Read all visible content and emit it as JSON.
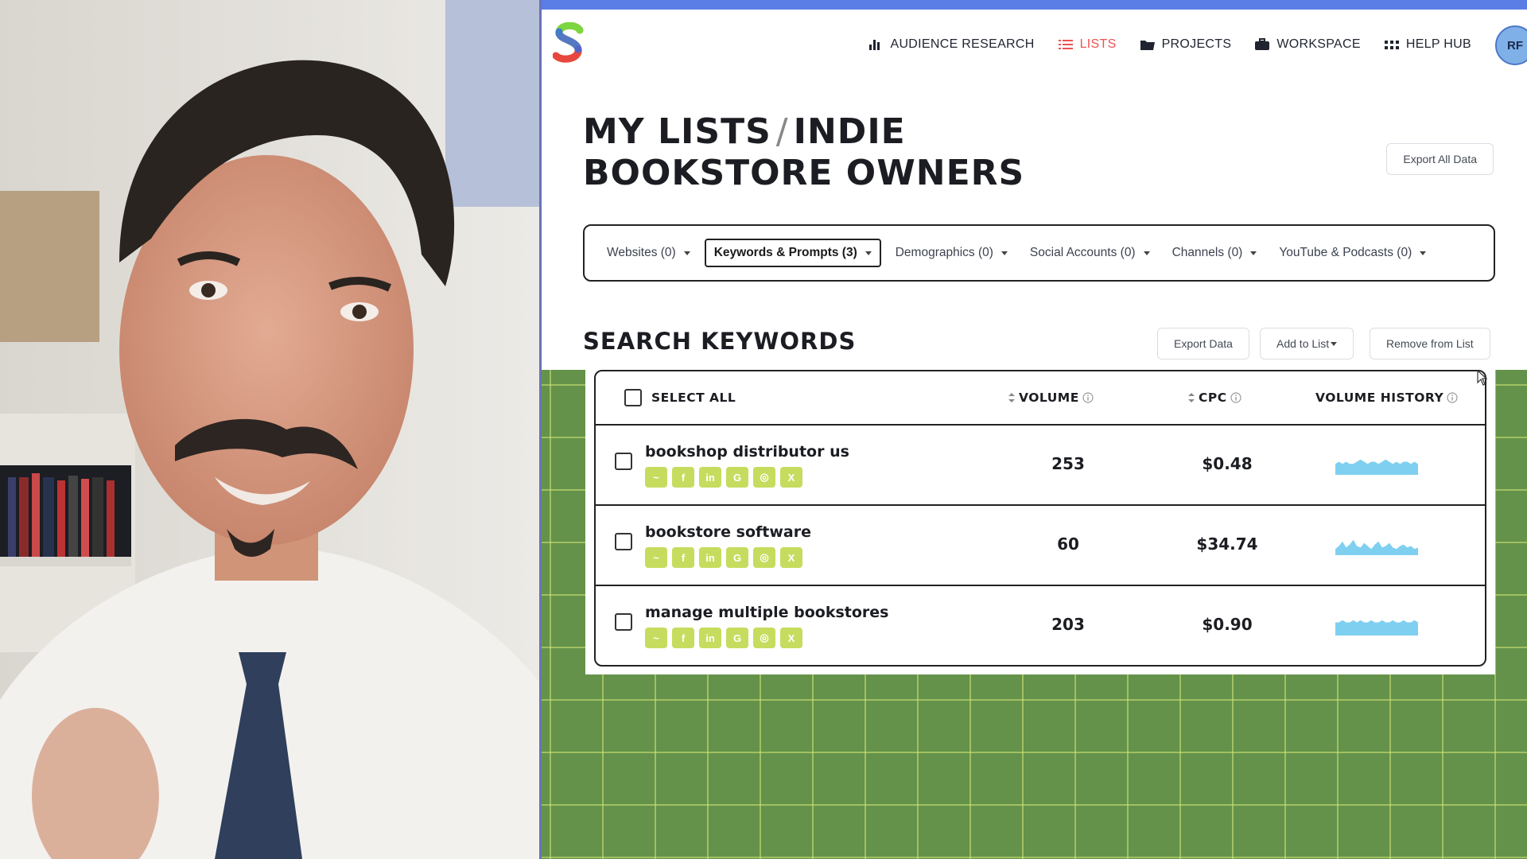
{
  "nav": {
    "items": [
      {
        "label": "AUDIENCE RESEARCH",
        "icon": "bar-chart-icon",
        "active": false
      },
      {
        "label": "LISTS",
        "icon": "list-icon",
        "active": true
      },
      {
        "label": "PROJECTS",
        "icon": "folder-icon",
        "active": false
      },
      {
        "label": "WORKSPACE",
        "icon": "briefcase-icon",
        "active": false
      },
      {
        "label": "HELP HUB",
        "icon": "grid-icon",
        "active": false
      }
    ],
    "avatar_initials": "RF"
  },
  "page": {
    "title_part1": "MY LISTS",
    "title_sep": "/",
    "title_part2": "INDIE BOOKSTORE OWNERS",
    "export_all_label": "Export All Data"
  },
  "tabs": [
    {
      "label": "Websites (0)",
      "active": false
    },
    {
      "label": "Keywords & Prompts (3)",
      "active": true
    },
    {
      "label": "Demographics (0)",
      "active": false
    },
    {
      "label": "Social Accounts (0)",
      "active": false
    },
    {
      "label": "Channels (0)",
      "active": false
    },
    {
      "label": "YouTube & Podcasts (0)",
      "active": false
    }
  ],
  "section": {
    "title": "SEARCH KEYWORDS",
    "export_data_label": "Export Data",
    "add_to_list_label": "Add to List",
    "remove_from_list_label": "Remove from List"
  },
  "table": {
    "select_all_label": "SELECT ALL",
    "col_volume": "VOLUME",
    "col_cpc": "CPC",
    "col_history": "VOLUME HISTORY",
    "rows": [
      {
        "keyword": "bookshop distributor us",
        "volume": "253",
        "cpc": "$0.48",
        "history": [
          5,
          6,
          5,
          6,
          5,
          5,
          6,
          7,
          6,
          5,
          6,
          6,
          5,
          6,
          7,
          6,
          5,
          6,
          5,
          6,
          6,
          5,
          6,
          5
        ]
      },
      {
        "keyword": "bookstore software",
        "volume": "60",
        "cpc": "$34.74",
        "history": [
          4,
          6,
          9,
          5,
          7,
          10,
          6,
          5,
          8,
          6,
          4,
          7,
          9,
          5,
          6,
          8,
          5,
          4,
          6,
          7,
          5,
          6,
          4,
          5
        ]
      },
      {
        "keyword": "manage multiple bookstores",
        "volume": "203",
        "cpc": "$0.90",
        "history": [
          6,
          6,
          7,
          6,
          6,
          7,
          6,
          7,
          6,
          6,
          7,
          6,
          6,
          7,
          6,
          6,
          7,
          6,
          6,
          7,
          6,
          6,
          7,
          6
        ]
      }
    ],
    "social_icons": [
      "trend-icon",
      "facebook-icon",
      "linkedin-icon",
      "google-icon",
      "instagram-icon",
      "x-icon"
    ],
    "social_glyphs": [
      "~",
      "f",
      "in",
      "G",
      "◎",
      "X"
    ]
  },
  "colors": {
    "accent_blue": "#5b7de6",
    "nav_active": "#ee5252",
    "grid_green": "#64924a",
    "social_chip": "#c6dc5e",
    "spark_fill": "#7fd0f0"
  }
}
